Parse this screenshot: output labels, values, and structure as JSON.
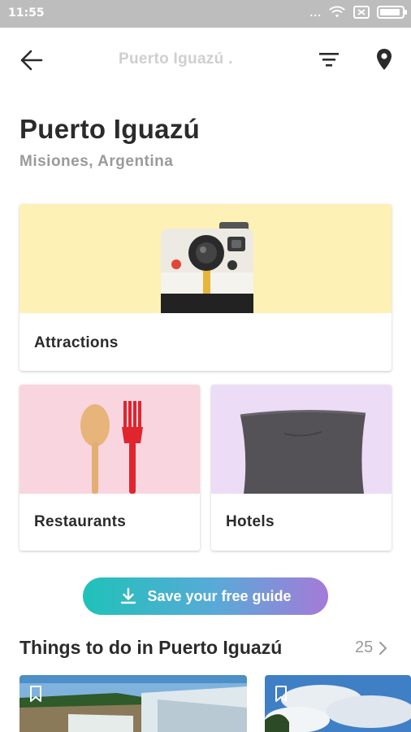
{
  "status_bar": {
    "time": "11:55",
    "dots": "...",
    "icons": [
      "wifi-icon",
      "sim-icon",
      "battery-icon"
    ]
  },
  "app_bar": {
    "title": "Puerto Iguazú .",
    "icons": [
      "back-arrow-icon",
      "filter-icon",
      "location-pin-icon"
    ]
  },
  "header": {
    "title": "Puerto Iguazú",
    "subtitle": "Misiones, Argentina"
  },
  "categories": [
    {
      "label": "Attractions",
      "color": "#fdf1b5",
      "icon": "instant-camera-illustration"
    },
    {
      "label": "Restaurants",
      "color": "#f9d6df",
      "icon": "spoon-fork-illustration"
    },
    {
      "label": "Hotels",
      "color": "#ecdcf5",
      "icon": "pillow-illustration"
    }
  ],
  "save_guide": {
    "label": "Save your free guide",
    "icon": "download-icon",
    "gradient": [
      "#1fc2b9",
      "#a57ad8"
    ]
  },
  "things_to_do": {
    "title": "Things to do in Puerto Iguazú",
    "count": "25",
    "icon": "chevron-right-icon",
    "items": [
      {
        "image": "waterfall-photo",
        "icon": "bookmark-icon"
      },
      {
        "image": "sky-clouds-photo",
        "icon": "bookmark-icon"
      }
    ]
  },
  "colors": {
    "text_dark": "#2b2b2b",
    "text_muted": "#9a9a9a",
    "status_bar_bg": "#bdbdbd"
  }
}
